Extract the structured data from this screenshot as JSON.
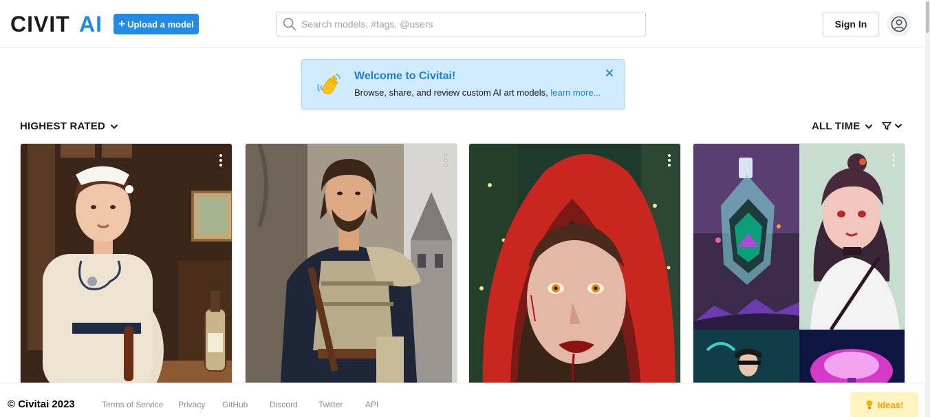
{
  "header": {
    "logo_text_dark": "CIVIT",
    "logo_text_accent": "AI",
    "upload_label": "Upload a model",
    "search_placeholder": "Search models, #tags, @users",
    "signin_label": "Sign In"
  },
  "welcome": {
    "title": "Welcome to Civitai!",
    "body": "Browse, share, and review custom AI art models, ",
    "link": "learn more..."
  },
  "sort": {
    "label": "HIGHEST RATED"
  },
  "period": {
    "label": "ALL TIME"
  },
  "cards": [
    {
      "subject": "nurse portrait",
      "icon": "more-vertical-icon"
    },
    {
      "subject": "armored knight",
      "icon": "more-vertical-icon"
    },
    {
      "subject": "red hood woman",
      "icon": "more-vertical-icon"
    },
    {
      "subject": "fantasy collage",
      "icon": "more-vertical-icon"
    }
  ],
  "footer": {
    "copyright": "© Civitai 2023",
    "links": [
      "Terms of Service",
      "Privacy",
      "GitHub",
      "Discord",
      "Twitter",
      "API"
    ],
    "ideas_label": "Ideas!"
  },
  "colors": {
    "accent": "#228be6",
    "alert_bg": "#d0ebff",
    "ideas_bg": "#fff3bf"
  }
}
